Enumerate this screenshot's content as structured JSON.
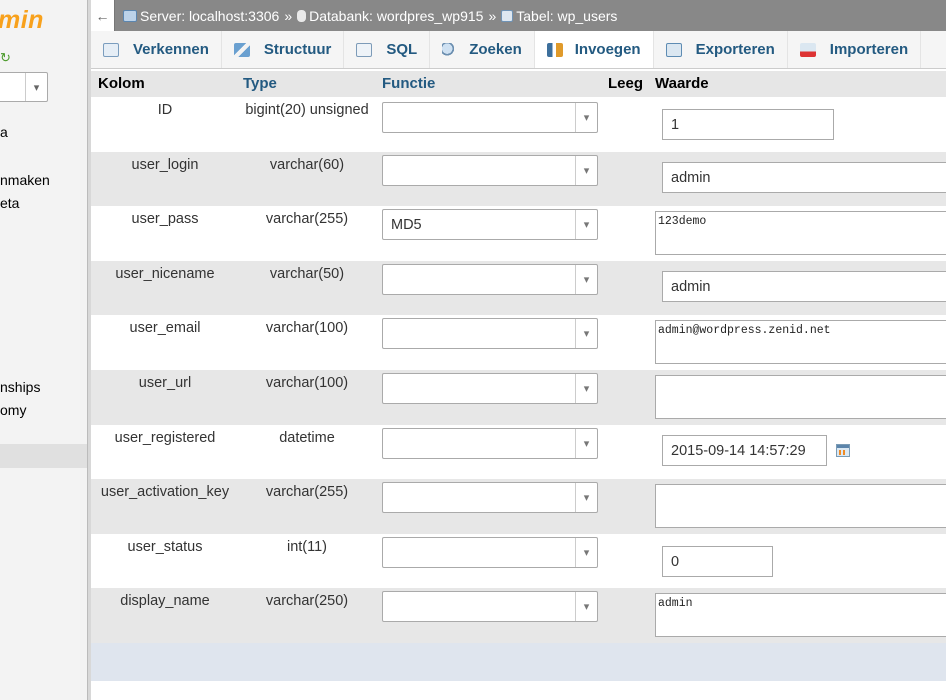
{
  "sidebar": {
    "logo_text": "min",
    "items": [
      {
        "label": "a"
      },
      {
        "label": "nmaken"
      },
      {
        "label": "eta"
      },
      {
        "label": "nships"
      },
      {
        "label": "omy"
      }
    ]
  },
  "breadcrumb": {
    "back": "←",
    "server": "Server: localhost:3306",
    "database": "Databank: wordpres_wp915",
    "table": "Tabel: wp_users",
    "separator": "»"
  },
  "tabs": [
    {
      "label": "Verkennen",
      "icon": "browse-icon"
    },
    {
      "label": "Structuur",
      "icon": "structure-icon"
    },
    {
      "label": "SQL",
      "icon": "sql-icon"
    },
    {
      "label": "Zoeken",
      "icon": "search-icon"
    },
    {
      "label": "Invoegen",
      "icon": "insert-icon"
    },
    {
      "label": "Exporteren",
      "icon": "export-icon"
    },
    {
      "label": "Importeren",
      "icon": "import-icon"
    }
  ],
  "active_tab": "Invoegen",
  "table_headers": {
    "kolom": "Kolom",
    "type": "Type",
    "functie": "Functie",
    "leeg": "Leeg",
    "waarde": "Waarde"
  },
  "rows": [
    {
      "name": "ID",
      "type": "bigint(20) unsigned",
      "function": "",
      "value": "1",
      "input": "text"
    },
    {
      "name": "user_login",
      "type": "varchar(60)",
      "function": "",
      "value": "admin",
      "input": "text"
    },
    {
      "name": "user_pass",
      "type": "varchar(255)",
      "function": "MD5",
      "value": "123demo",
      "input": "textarea"
    },
    {
      "name": "user_nicename",
      "type": "varchar(50)",
      "function": "",
      "value": "admin",
      "input": "text"
    },
    {
      "name": "user_email",
      "type": "varchar(100)",
      "function": "",
      "value": "admin@wordpress.zenid.net",
      "input": "textarea"
    },
    {
      "name": "user_url",
      "type": "varchar(100)",
      "function": "",
      "value": "",
      "input": "textarea"
    },
    {
      "name": "user_registered",
      "type": "datetime",
      "function": "",
      "value": "2015-09-14 14:57:29",
      "input": "datetime"
    },
    {
      "name": "user_activation_key",
      "type": "varchar(255)",
      "function": "",
      "value": "",
      "input": "textarea"
    },
    {
      "name": "user_status",
      "type": "int(11)",
      "function": "",
      "value": "0",
      "input": "text"
    },
    {
      "name": "display_name",
      "type": "varchar(250)",
      "function": "",
      "value": "admin",
      "input": "textarea"
    }
  ],
  "colors": {
    "link_blue": "#235a81",
    "logo_orange": "#f8a11c",
    "topbar_gray": "#888888",
    "row_alt": "#e7e7e7"
  }
}
